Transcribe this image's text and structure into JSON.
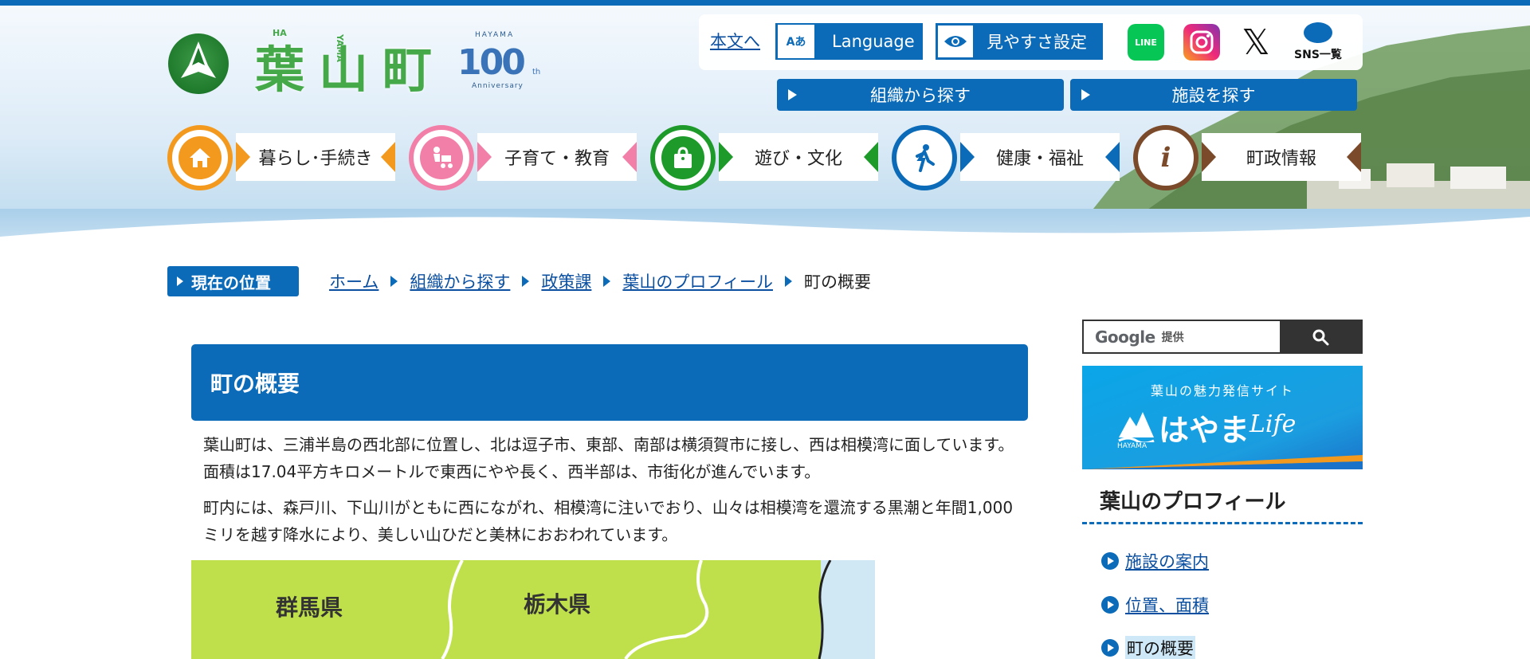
{
  "header": {
    "logo_text": "葉山町",
    "logo_ruby": [
      "HA",
      "YAMA",
      ""
    ],
    "anniversary": {
      "top": "HAYAMA",
      "num": "100",
      "suffix": "th",
      "bottom": "Anniversary"
    },
    "skip_link": "本文へ",
    "language_label": "Language",
    "language_icon_text": "Aあ",
    "view_settings_label": "見やすさ設定",
    "sns": {
      "line_label": "LINE",
      "x_label": "𝕏",
      "all_label": "SNS一覧"
    },
    "search_org_label": "組織から探す",
    "search_fac_label": "施設を探す"
  },
  "nav": [
    {
      "label": "暮らし･手続き",
      "color": "#f39a1e",
      "icon": "house-icon"
    },
    {
      "label": "子育て・教育",
      "color": "#f27fa7",
      "icon": "stroller-icon"
    },
    {
      "label": "遊び・文化",
      "color": "#1e9a2a",
      "icon": "bag-icon"
    },
    {
      "label": "健康・福祉",
      "color": "#0b6bb8",
      "icon": "walking-person-icon"
    },
    {
      "label": "町政情報",
      "color": "#7a4a2a",
      "icon": "info-icon"
    }
  ],
  "breadcrumb": {
    "tag": "現在の位置",
    "items": [
      "ホーム",
      "組織から探す",
      "政策課",
      "葉山のプロフィール"
    ],
    "current": "町の概要"
  },
  "main": {
    "title": "町の概要",
    "paragraphs": [
      " 葉山町は、三浦半島の西北部に位置し、北は逗子市、東部、南部は横須賀市に接し、西は相模湾に面しています。面積は17.04平方キロメートルで東西にやや長く、西半部は、市街化が進んでいます。",
      "町内には、森戸川、下山川がともに西にながれ、相模湾に注いでおり、山々は相模湾を還流する黒潮と年間1,000ミリを越す降水により、美しい山ひだと美林におおわれています。"
    ],
    "map_labels": [
      "群馬県",
      "栃木県"
    ]
  },
  "sidebar": {
    "search_brand": "Google",
    "search_provided": "提供",
    "banner_sub": "葉山の魅力発信サイト",
    "banner_main": "はやま",
    "banner_life": "Life",
    "banner_mark": "HAYAMA",
    "section_title": "葉山のプロフィール",
    "links": [
      "施設の案内",
      "位置、面積"
    ],
    "current": "町の概要"
  }
}
